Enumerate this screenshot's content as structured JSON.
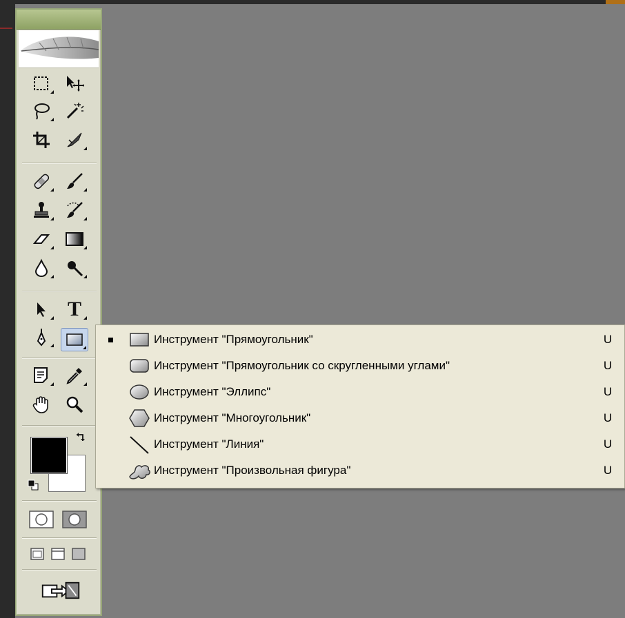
{
  "toolbox": {
    "tools": [
      {
        "name": "rectangular-marquee-tool",
        "icon": "marquee-icon"
      },
      {
        "name": "move-tool",
        "icon": "move-icon"
      },
      {
        "name": "lasso-tool",
        "icon": "lasso-icon"
      },
      {
        "name": "magic-wand-tool",
        "icon": "magic-wand-icon"
      },
      {
        "name": "crop-tool",
        "icon": "crop-icon"
      },
      {
        "name": "slice-tool",
        "icon": "slice-icon"
      },
      {
        "name": "healing-brush-tool",
        "icon": "bandage-icon"
      },
      {
        "name": "brush-tool",
        "icon": "brush-icon"
      },
      {
        "name": "clone-stamp-tool",
        "icon": "stamp-icon"
      },
      {
        "name": "history-brush-tool",
        "icon": "history-brush-icon"
      },
      {
        "name": "eraser-tool",
        "icon": "eraser-icon"
      },
      {
        "name": "gradient-tool",
        "icon": "gradient-icon"
      },
      {
        "name": "blur-tool",
        "icon": "drop-icon"
      },
      {
        "name": "dodge-tool",
        "icon": "dodge-icon"
      },
      {
        "name": "path-selection-tool",
        "icon": "arrow-icon"
      },
      {
        "name": "type-tool",
        "icon": "type-icon"
      },
      {
        "name": "pen-tool",
        "icon": "pen-icon"
      },
      {
        "name": "shape-tool",
        "icon": "rectangle-shape-icon"
      },
      {
        "name": "notes-tool",
        "icon": "notes-icon"
      },
      {
        "name": "eyedropper-tool",
        "icon": "eyedropper-icon"
      },
      {
        "name": "hand-tool",
        "icon": "hand-icon"
      },
      {
        "name": "zoom-tool",
        "icon": "magnifier-icon"
      }
    ],
    "type_label": "T",
    "foreground_color": "#000000",
    "background_color": "#ffffff"
  },
  "shape_menu": {
    "items": [
      {
        "label": "Инструмент \"Прямоугольник\"",
        "shortcut": "U",
        "checked": true,
        "icon": "rectangle-icon"
      },
      {
        "label": "Инструмент \"Прямоугольник со скругленными углами\"",
        "shortcut": "U",
        "checked": false,
        "icon": "rounded-rectangle-icon"
      },
      {
        "label": "Инструмент \"Эллипс\"",
        "shortcut": "U",
        "checked": false,
        "icon": "ellipse-icon"
      },
      {
        "label": "Инструмент \"Многоугольник\"",
        "shortcut": "U",
        "checked": false,
        "icon": "polygon-icon"
      },
      {
        "label": "Инструмент \"Линия\"",
        "shortcut": "U",
        "checked": false,
        "icon": "line-icon"
      },
      {
        "label": "Инструмент \"Произвольная фигура\"",
        "shortcut": "U",
        "checked": false,
        "icon": "custom-shape-icon"
      }
    ]
  }
}
